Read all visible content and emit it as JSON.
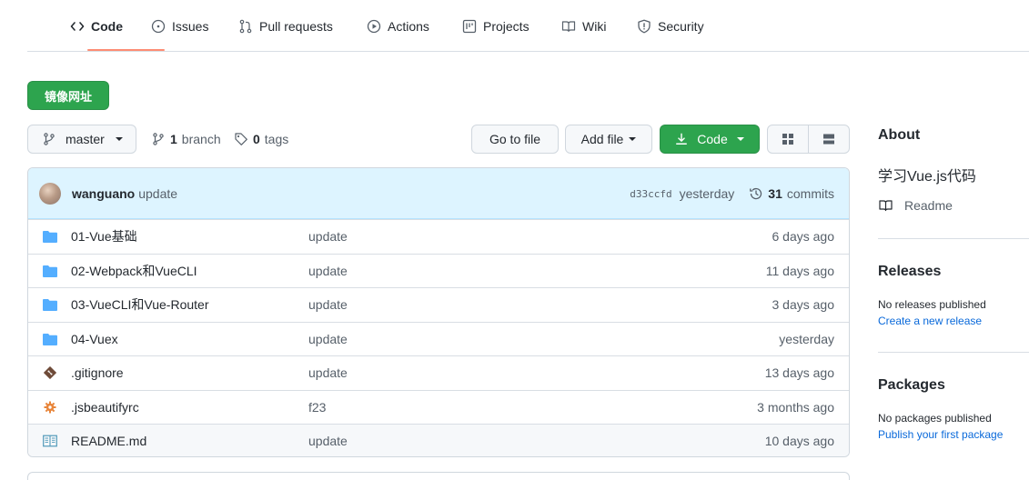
{
  "nav": {
    "tabs": [
      {
        "label": "Code",
        "icon": "code-icon",
        "active": true
      },
      {
        "label": "Issues",
        "icon": "issue-icon"
      },
      {
        "label": "Pull requests",
        "icon": "pull-request-icon"
      },
      {
        "label": "Actions",
        "icon": "play-icon"
      },
      {
        "label": "Projects",
        "icon": "project-icon"
      },
      {
        "label": "Wiki",
        "icon": "book-icon"
      },
      {
        "label": "Security",
        "icon": "shield-icon"
      }
    ]
  },
  "mirror_button": "镜像网址",
  "toolbar": {
    "branch_select": "master",
    "branch_count": "1",
    "branch_label": "branch",
    "tag_count": "0",
    "tag_label": "tags",
    "go_to_file": "Go to file",
    "add_file": "Add file",
    "code": "Code"
  },
  "commit": {
    "author": "wanguano",
    "message": "update",
    "sha": "d33ccfd",
    "time": "yesterday",
    "commit_count": "31",
    "commit_label": "commits"
  },
  "files": [
    {
      "name": "01-Vue基础",
      "type": "folder",
      "message": "update",
      "age": "6 days ago"
    },
    {
      "name": "02-Webpack和VueCLI",
      "type": "folder",
      "message": "update",
      "age": "11 days ago"
    },
    {
      "name": "03-VueCLI和Vue-Router",
      "type": "folder",
      "message": "update",
      "age": "3 days ago"
    },
    {
      "name": "04-Vuex",
      "type": "folder",
      "message": "update",
      "age": "yesterday"
    },
    {
      "name": ".gitignore",
      "type": "git-file",
      "message": "update",
      "age": "13 days ago"
    },
    {
      "name": ".jsbeautifyrc",
      "type": "config-file",
      "message": "f23",
      "age": "3 months ago"
    },
    {
      "name": "README.md",
      "type": "readme-file",
      "message": "update",
      "age": "10 days ago"
    }
  ],
  "sidebar": {
    "about_title": "About",
    "description": "学习Vue.js代码",
    "readme_label": "Readme",
    "releases_title": "Releases",
    "releases_empty": "No releases published",
    "releases_link": "Create a new release",
    "packages_title": "Packages",
    "packages_empty": "No packages published",
    "packages_link": "Publish your first package"
  },
  "colors": {
    "primary_green": "#2da44e",
    "tab_underline": "#fd8c73",
    "folder_blue": "#54aeff",
    "link_blue": "#0969da",
    "commit_bg": "#ddf4ff"
  }
}
